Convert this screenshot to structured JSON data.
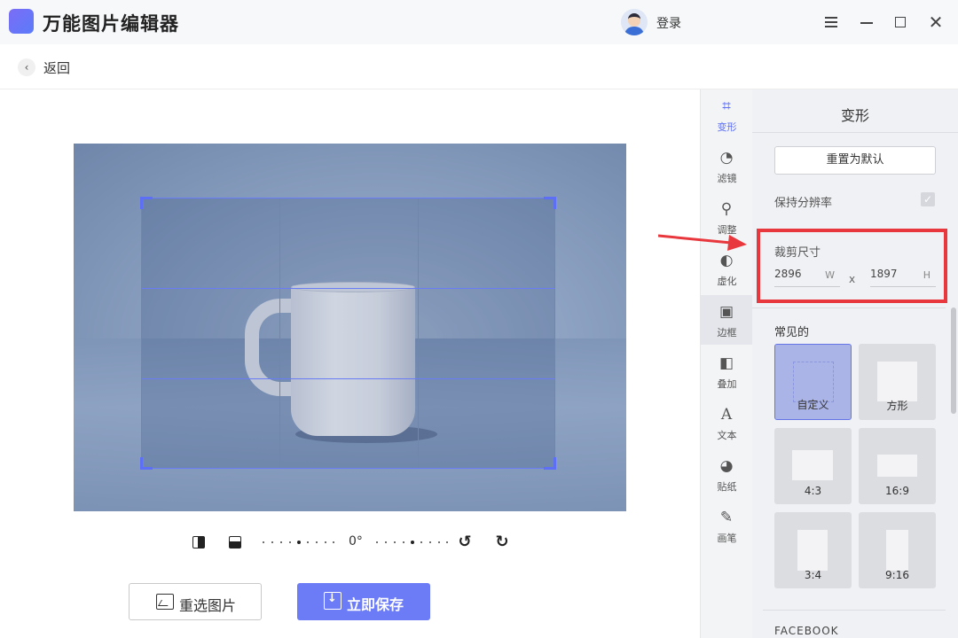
{
  "app": {
    "title": "万能图片编辑器",
    "login": "登录"
  },
  "nav": {
    "back": "返回"
  },
  "canvas": {
    "angle": "0°"
  },
  "actions": {
    "reselect": "重选图片",
    "save": "立即保存"
  },
  "tools": [
    {
      "label": "变形",
      "icon": "crop-icon",
      "glyph": "⌗"
    },
    {
      "label": "滤镜",
      "icon": "filter-icon",
      "glyph": "◔"
    },
    {
      "label": "调整",
      "icon": "adjust-icon",
      "glyph": "⚲"
    },
    {
      "label": "虚化",
      "icon": "blur-icon",
      "glyph": "◐"
    },
    {
      "label": "边框",
      "icon": "border-icon",
      "glyph": "▣"
    },
    {
      "label": "叠加",
      "icon": "overlay-icon",
      "glyph": "◧"
    },
    {
      "label": "文本",
      "icon": "text-icon",
      "glyph": "A"
    },
    {
      "label": "贴纸",
      "icon": "sticker-icon",
      "glyph": "◕"
    },
    {
      "label": "画笔",
      "icon": "brush-icon",
      "glyph": "✎"
    }
  ],
  "panel": {
    "title": "变形",
    "reset": "重置为默认",
    "keep_resolution": "保持分辨率",
    "crop_size": {
      "label": "裁剪尺寸",
      "width": "2896",
      "width_unit": "W",
      "separator": "x",
      "height": "1897",
      "height_unit": "H"
    },
    "common_label": "常见的",
    "presets": [
      {
        "label": "自定义",
        "selected": true
      },
      {
        "label": "方形",
        "selected": false
      },
      {
        "label": "4:3",
        "selected": false
      },
      {
        "label": "16:9",
        "selected": false
      },
      {
        "label": "3:4",
        "selected": false
      },
      {
        "label": "9:16",
        "selected": false
      }
    ],
    "facebook_label": "FACEBOOK"
  },
  "colors": {
    "accent": "#6c7cf6",
    "highlight": "#e8383d",
    "crop_line": "#6a7cf5"
  }
}
